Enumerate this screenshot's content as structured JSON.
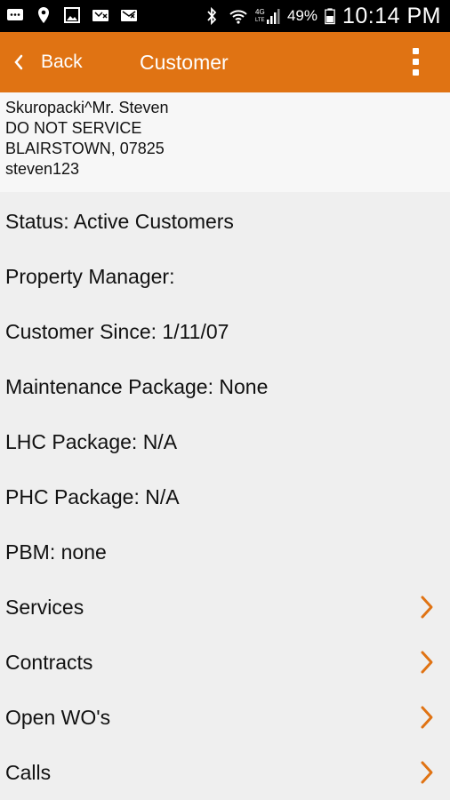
{
  "statusbar": {
    "battery_pct": "49%",
    "time": "10:14 PM",
    "network": "4G LTE",
    "icons": [
      "message-icon",
      "location-icon",
      "image-icon",
      "missed-call-icon",
      "voicemail-icon",
      "bluetooth-icon",
      "wifi-icon",
      "signal-icon",
      "battery-icon"
    ]
  },
  "appbar": {
    "back_label": "Back",
    "title": "Customer",
    "color": "#e07313"
  },
  "customer": {
    "name": "Skuropacki^Mr. Steven",
    "note": "DO NOT SERVICE",
    "location": "BLAIRSTOWN, 07825",
    "username": "steven123"
  },
  "details": [
    {
      "label": "Status: Active Customers"
    },
    {
      "label": "Property Manager:"
    },
    {
      "label": "Customer Since: 1/11/07"
    },
    {
      "label": "Maintenance Package: None"
    },
    {
      "label": "LHC Package: N/A"
    },
    {
      "label": "PHC Package: N/A"
    },
    {
      "label": "PBM: none"
    }
  ],
  "links": [
    {
      "label": "Services"
    },
    {
      "label": "Contracts"
    },
    {
      "label": "Open WO's"
    },
    {
      "label": "Calls"
    }
  ],
  "accent": "#e07313"
}
